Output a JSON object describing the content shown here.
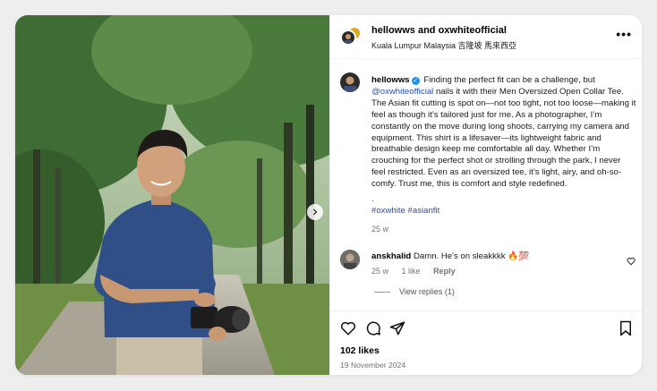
{
  "header": {
    "title": "hellowws and oxwhiteofficial",
    "location": "Kuala Lumpur Malaysia 吉隆坡 馬來西亞"
  },
  "caption": {
    "username": "hellowws",
    "text_before_mention": "Finding the perfect fit can be a challenge, but",
    "mention": "@oxwhiteofficial",
    "text_after_mention": "nails it with their Men Oversized Open Collar Tee. The Asian fit cutting is spot on—not too tight, not too loose—making it feel as though it’s tailored just for me. As a photographer, I’m constantly on the move during long shoots, carrying my camera and equipment. This shirt is a lifesaver—its lightweight fabric and breathable design keep me comfortable all day. Whether I’m crouching for the perfect shot or strolling through the park, I never feel restricted. Even as an oversized tee, it’s light, airy, and oh-so-comfy. Trust me, this is comfort and style redefined.",
    "dot": ".",
    "hashtags": "#oxwhite #asianfit",
    "time": "25 w"
  },
  "comment": {
    "username": "anskhalid",
    "text": "Damn. He's on sleakkkk 🔥💯",
    "time": "25 w",
    "likes": "1 like",
    "reply": "Reply",
    "view_replies": "View replies (1)"
  },
  "post": {
    "likes": "102 likes",
    "date": "19 November 2024"
  },
  "icons": {
    "verified": "verified-badge",
    "more": "more-options-icon",
    "next": "chevron-right-icon",
    "like": "heart-icon",
    "comment": "comment-icon",
    "share": "paper-plane-icon",
    "save": "bookmark-icon"
  },
  "colors": {
    "verified": "#1f8ff0",
    "link": "#2a4fa8",
    "meta": "#737373"
  }
}
